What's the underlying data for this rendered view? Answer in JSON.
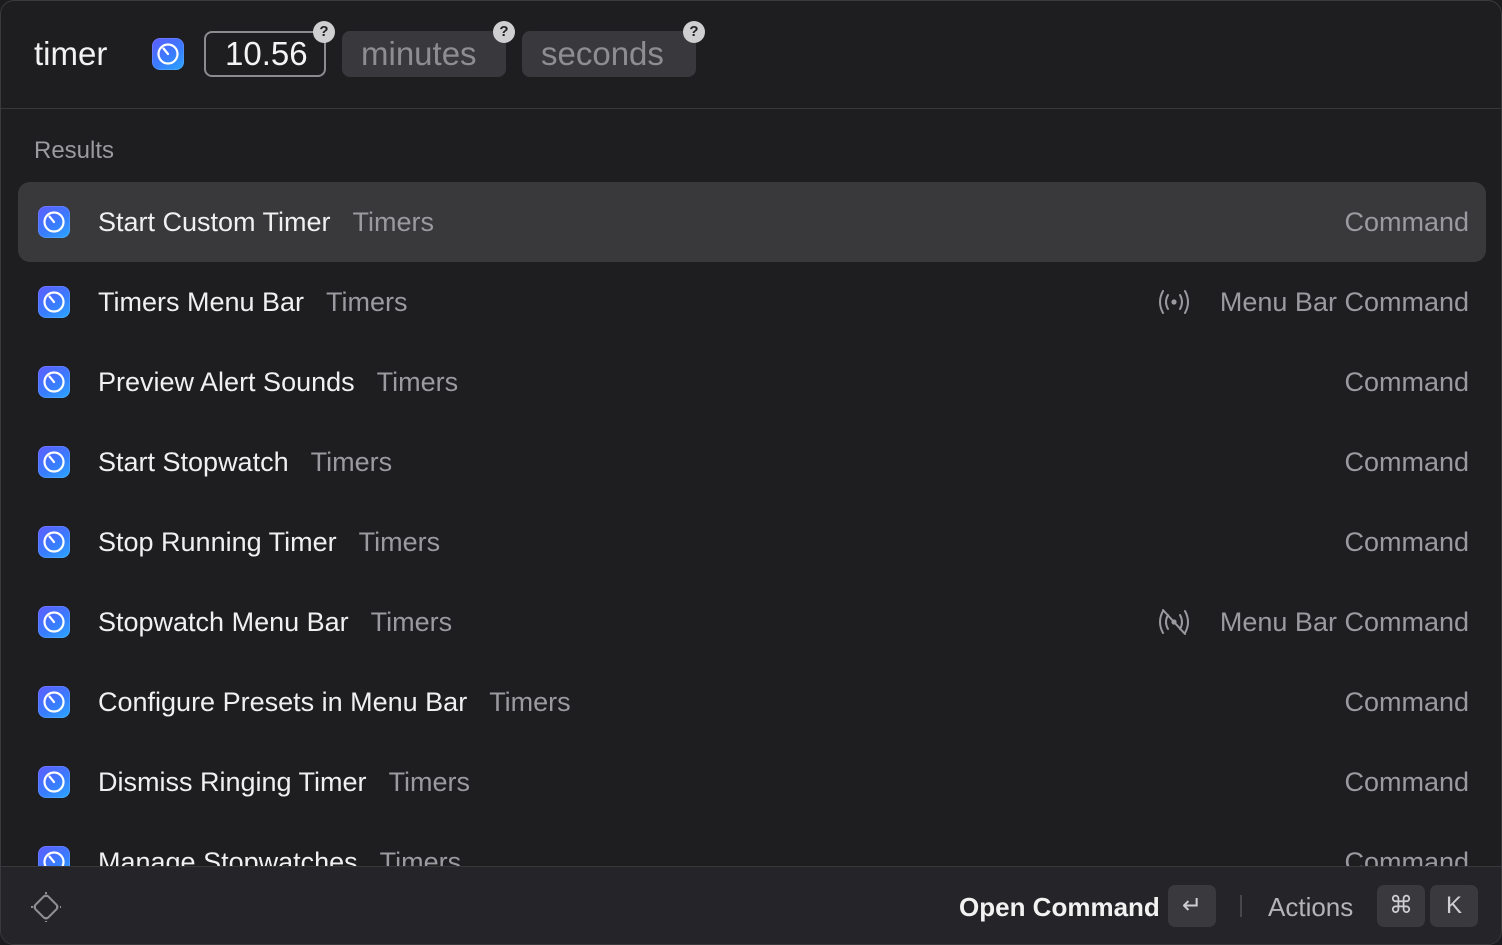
{
  "search": {
    "command_name": "timer",
    "arguments": [
      {
        "value": "10.56",
        "placeholder": ""
      },
      {
        "value": "",
        "placeholder": "minutes"
      },
      {
        "value": "",
        "placeholder": "seconds"
      }
    ],
    "help_glyph": "?"
  },
  "results": {
    "section_title": "Results",
    "items": [
      {
        "title": "Start Custom Timer",
        "subtitle": "Timers",
        "type": "Command",
        "accessory_icon": "",
        "selected": true
      },
      {
        "title": "Timers Menu Bar",
        "subtitle": "Timers",
        "type": "Menu Bar Command",
        "accessory_icon": "broadcast-icon",
        "selected": false
      },
      {
        "title": "Preview Alert Sounds",
        "subtitle": "Timers",
        "type": "Command",
        "accessory_icon": "",
        "selected": false
      },
      {
        "title": "Start Stopwatch",
        "subtitle": "Timers",
        "type": "Command",
        "accessory_icon": "",
        "selected": false
      },
      {
        "title": "Stop Running Timer",
        "subtitle": "Timers",
        "type": "Command",
        "accessory_icon": "",
        "selected": false
      },
      {
        "title": "Stopwatch Menu Bar",
        "subtitle": "Timers",
        "type": "Menu Bar Command",
        "accessory_icon": "broadcast-off-icon",
        "selected": false
      },
      {
        "title": "Configure Presets in Menu Bar",
        "subtitle": "Timers",
        "type": "Command",
        "accessory_icon": "",
        "selected": false
      },
      {
        "title": "Dismiss Ringing Timer",
        "subtitle": "Timers",
        "type": "Command",
        "accessory_icon": "",
        "selected": false
      },
      {
        "title": "Manage Stopwatches",
        "subtitle": "Timers",
        "type": "Command",
        "accessory_icon": "",
        "selected": false
      }
    ]
  },
  "actionbar": {
    "primary_action": "Open Command",
    "enter_key": "↵",
    "actions_label": "Actions",
    "cmd_key": "⌘",
    "k_key": "K"
  },
  "colors": {
    "background": "#1e1d20",
    "selected_row": "#39383b",
    "icon_gradient_start": "#5f5cff",
    "icon_gradient_end": "#2aa7ff"
  }
}
